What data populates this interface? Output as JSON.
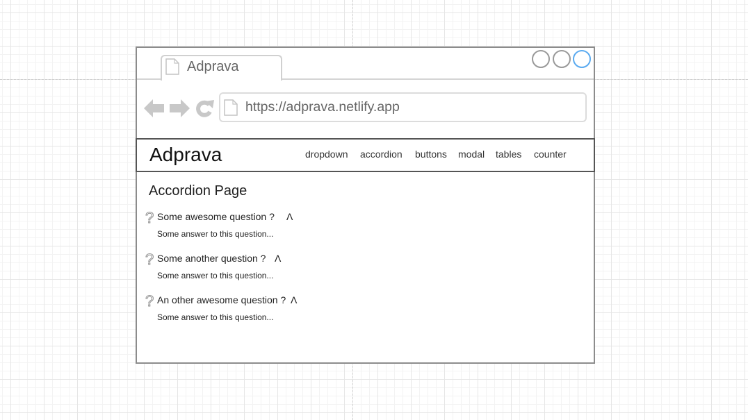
{
  "browser": {
    "tab_title": "Adprava",
    "url": "https://adprava.netlify.app",
    "window_controls": [
      "minimize",
      "maximize",
      "close"
    ],
    "icons": {
      "tab": "page-icon",
      "back": "back-arrow-icon",
      "forward": "forward-arrow-icon",
      "refresh": "refresh-icon",
      "url": "page-icon"
    }
  },
  "navbar": {
    "brand": "Adprava",
    "links": [
      {
        "label": "dropdown"
      },
      {
        "label": "accordion"
      },
      {
        "label": "buttons"
      },
      {
        "label": "modal"
      },
      {
        "label": "tables"
      },
      {
        "label": "counter"
      }
    ]
  },
  "page": {
    "title": "Accordion Page",
    "accordion": [
      {
        "icon": "?",
        "question": "Some awesome question ?",
        "toggle": "Λ",
        "answer": "Some answer to this question...",
        "expanded": true
      },
      {
        "icon": "?",
        "question": "Some another question ?",
        "toggle": "Λ",
        "answer": "Some answer to this question...",
        "expanded": true
      },
      {
        "icon": "?",
        "question": "An other awesome question ?",
        "toggle": "Λ",
        "answer": "Some answer to this question...",
        "expanded": true
      }
    ]
  },
  "colors": {
    "window_control": "#999999",
    "window_control_active": "#5aaaf0",
    "chrome_icon": "#c8c8c8",
    "question_icon": "#8f8f8f"
  }
}
